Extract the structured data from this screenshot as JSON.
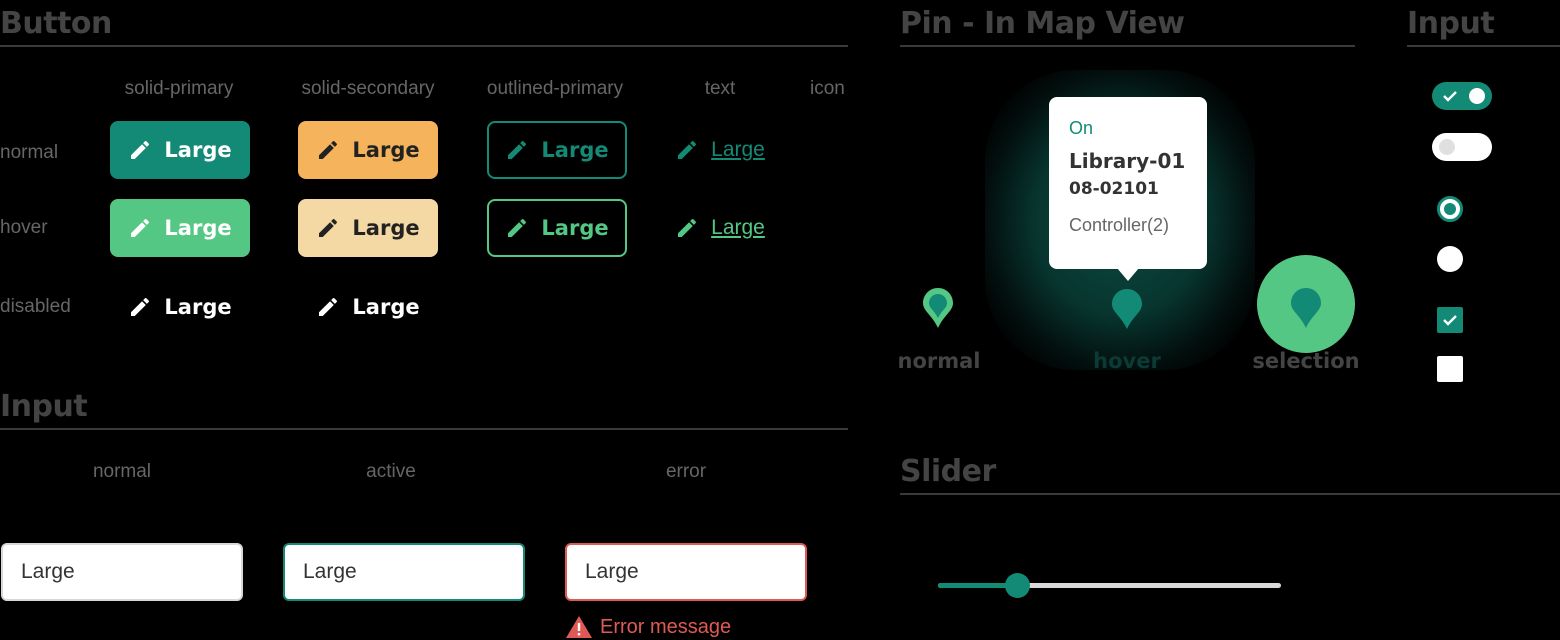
{
  "colors": {
    "primary": "#138a76",
    "primary_hover": "#55c785",
    "secondary": "#f5b45c",
    "secondary_hover": "#f5d9a5",
    "error": "#e05a55",
    "selection": "#55c785"
  },
  "button_section": {
    "title": "Button",
    "columns": [
      "solid-primary",
      "solid-secondary",
      "outlined-primary",
      "text",
      "icon"
    ],
    "rows": [
      "normal",
      "hover",
      "disabled"
    ],
    "button_label": "Large",
    "button_icon": "pencil-icon"
  },
  "pin_section": {
    "title": "Pin - In Map View",
    "labels": [
      "normal",
      "hover",
      "selection"
    ],
    "tooltip": {
      "status": "On",
      "name": "Library-01",
      "code": "08-02101",
      "sub": "Controller(2)"
    }
  },
  "input_side_section": {
    "title": "Input",
    "toggle_on_icon": "check-icon",
    "checkbox_checked_icon": "check-icon"
  },
  "input_section": {
    "title": "Input",
    "states": [
      "normal",
      "active",
      "error"
    ],
    "values": [
      "Large",
      "Large",
      "Large"
    ],
    "error_message": "Error message",
    "error_icon": "warning-icon"
  },
  "slider_section": {
    "title": "Slider",
    "value": 0.23
  }
}
